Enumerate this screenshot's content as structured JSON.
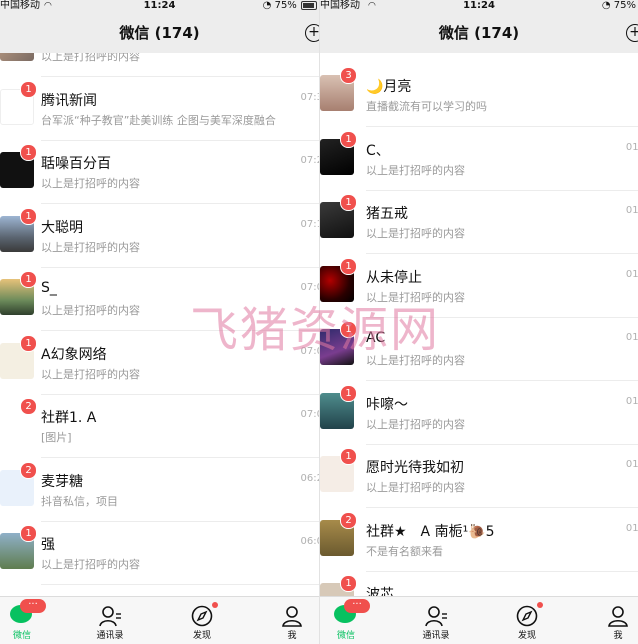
{
  "watermark": "飞猪资源网",
  "status_bar": {
    "carrier": "中国移动",
    "time": "11:24",
    "battery": "75%"
  },
  "left": {
    "title": "微信 (174)",
    "chats": [
      {
        "name": "",
        "message": "以上是打招呼的内容",
        "time": "",
        "badge": "",
        "avatar": "av-photo1"
      },
      {
        "name": "腾讯新闻",
        "message": "台军派“种子教官”赴美训练 企图与美军深度融合",
        "time": "07:3",
        "badge": "1",
        "avatar": "av-news"
      },
      {
        "name": "聒噪百分百",
        "message": "以上是打招呼的内容",
        "time": "07:2",
        "badge": "1",
        "avatar": "av-black"
      },
      {
        "name": "大聪明",
        "message": "以上是打招呼的内容",
        "time": "07:1",
        "badge": "1",
        "avatar": "av-scene"
      },
      {
        "name": "S_",
        "message": "以上是打招呼的内容",
        "time": "07:0",
        "badge": "1",
        "avatar": "av-sunset"
      },
      {
        "name": "A幻象网络",
        "message": "以上是打招呼的内容",
        "time": "07:0",
        "badge": "1",
        "avatar": "av-bike"
      },
      {
        "name": "社群1. A",
        "message": "[图片]",
        "time": "07:0",
        "badge": "2",
        "avatar": "av-white"
      },
      {
        "name": "麦芽糖",
        "message": "抖音私信，项目",
        "time": "06:2",
        "badge": "2",
        "avatar": "av-cartoon"
      },
      {
        "name": "强",
        "message": "以上是打招呼的内容",
        "time": "06:0",
        "badge": "1",
        "avatar": "av-frog"
      }
    ]
  },
  "right": {
    "title": "微信 (174)",
    "chats": [
      {
        "name": "🌙月亮",
        "message": "直播截流有可以学习的吗",
        "time": "",
        "badge": "3",
        "avatar": "av-girl"
      },
      {
        "name": "C、",
        "message": "以上是打招呼的内容",
        "time": "01:",
        "badge": "1",
        "avatar": "av-dark1"
      },
      {
        "name": "猪五戒",
        "message": "以上是打招呼的内容",
        "time": "01:",
        "badge": "1",
        "avatar": "av-dark2"
      },
      {
        "name": "从未停止",
        "message": "以上是打招呼的内容",
        "time": "01:",
        "badge": "1",
        "avatar": "av-red"
      },
      {
        "name": "AC",
        "message": "以上是打招呼的内容",
        "time": "01:",
        "badge": "1",
        "avatar": "av-purple"
      },
      {
        "name": "咔嚓～",
        "message": "以上是打招呼的内容",
        "time": "01:",
        "badge": "1",
        "avatar": "av-teal"
      },
      {
        "name": "愿时光待我如初",
        "message": "以上是打招呼的内容",
        "time": "01:",
        "badge": "1",
        "avatar": "av-sketch"
      },
      {
        "name": "社群★　A 南栀¹🐌5",
        "message": "不是有名额来看",
        "time": "01:",
        "badge": "2",
        "avatar": "av-brown"
      },
      {
        "name": "波芯",
        "message": "",
        "time": "",
        "badge": "1",
        "avatar": "av-misc"
      }
    ]
  },
  "tabs": {
    "chats": "微信",
    "contacts": "通讯录",
    "discover": "发现",
    "me": "我",
    "chats_badge": "···"
  },
  "colors": {
    "accent": "#07c160",
    "badge": "#f0504d",
    "header_bg": "#ededed"
  }
}
